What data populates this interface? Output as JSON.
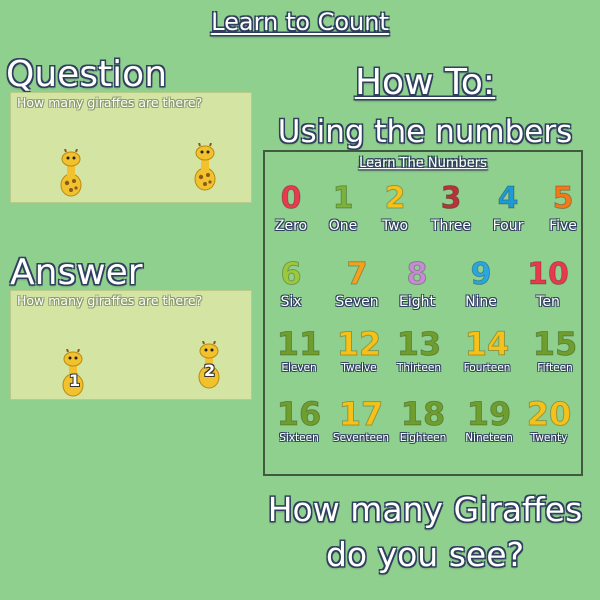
{
  "title": "Learn to Count",
  "question": {
    "heading": "Question",
    "caption": "How many giraffes are there?"
  },
  "answer": {
    "heading": "Answer",
    "caption": "How many giraffes are there?",
    "giraffe_labels": [
      "1",
      "2"
    ]
  },
  "howto": {
    "heading": "How To:",
    "subheading": "Using the numbers"
  },
  "numbers_panel": {
    "title": "Learn The Numbers",
    "numbers": [
      {
        "digit": "0",
        "word": "Zero",
        "color": "#e8394f"
      },
      {
        "digit": "1",
        "word": "One",
        "color": "#7ab23a"
      },
      {
        "digit": "2",
        "word": "Two",
        "color": "#f4c21a"
      },
      {
        "digit": "3",
        "word": "Three",
        "color": "#b8323a"
      },
      {
        "digit": "4",
        "word": "Four",
        "color": "#1e9ad6"
      },
      {
        "digit": "5",
        "word": "Five",
        "color": "#f07a1c"
      },
      {
        "digit": "6",
        "word": "Six",
        "color": "#9cc83c"
      },
      {
        "digit": "7",
        "word": "Seven",
        "color": "#f2a21e"
      },
      {
        "digit": "8",
        "word": "Eight",
        "color": "#c78ad6"
      },
      {
        "digit": "9",
        "word": "Nine",
        "color": "#2aa6e0"
      },
      {
        "digit": "10",
        "word": "Ten",
        "color": "#e8394f"
      },
      {
        "digit": "11",
        "word": "Eleven",
        "color": "#6f9e2e"
      },
      {
        "digit": "12",
        "word": "Twelve",
        "color": "#f4c21a"
      },
      {
        "digit": "13",
        "word": "Thirteen",
        "color": "#6f9e2e"
      },
      {
        "digit": "14",
        "word": "Fourteen",
        "color": "#f4c21a"
      },
      {
        "digit": "15",
        "word": "Fifteen",
        "color": "#6f9e2e"
      },
      {
        "digit": "16",
        "word": "Sixteen",
        "color": "#6f9e2e"
      },
      {
        "digit": "17",
        "word": "Seventeen",
        "color": "#f4c21a"
      },
      {
        "digit": "18",
        "word": "Eighteen",
        "color": "#6f9e2e"
      },
      {
        "digit": "19",
        "word": "Nineteen",
        "color": "#6f9e2e"
      },
      {
        "digit": "20",
        "word": "Twenty",
        "color": "#f4c21a"
      }
    ]
  },
  "bottom_prompt": {
    "line1": "How many Giraffes",
    "line2": "do you see?"
  },
  "colors": {
    "background": "#90d08f",
    "slide": "#d4e4a3",
    "giraffe_body": "#f2c12e",
    "giraffe_spots": "#8a5a1a"
  }
}
